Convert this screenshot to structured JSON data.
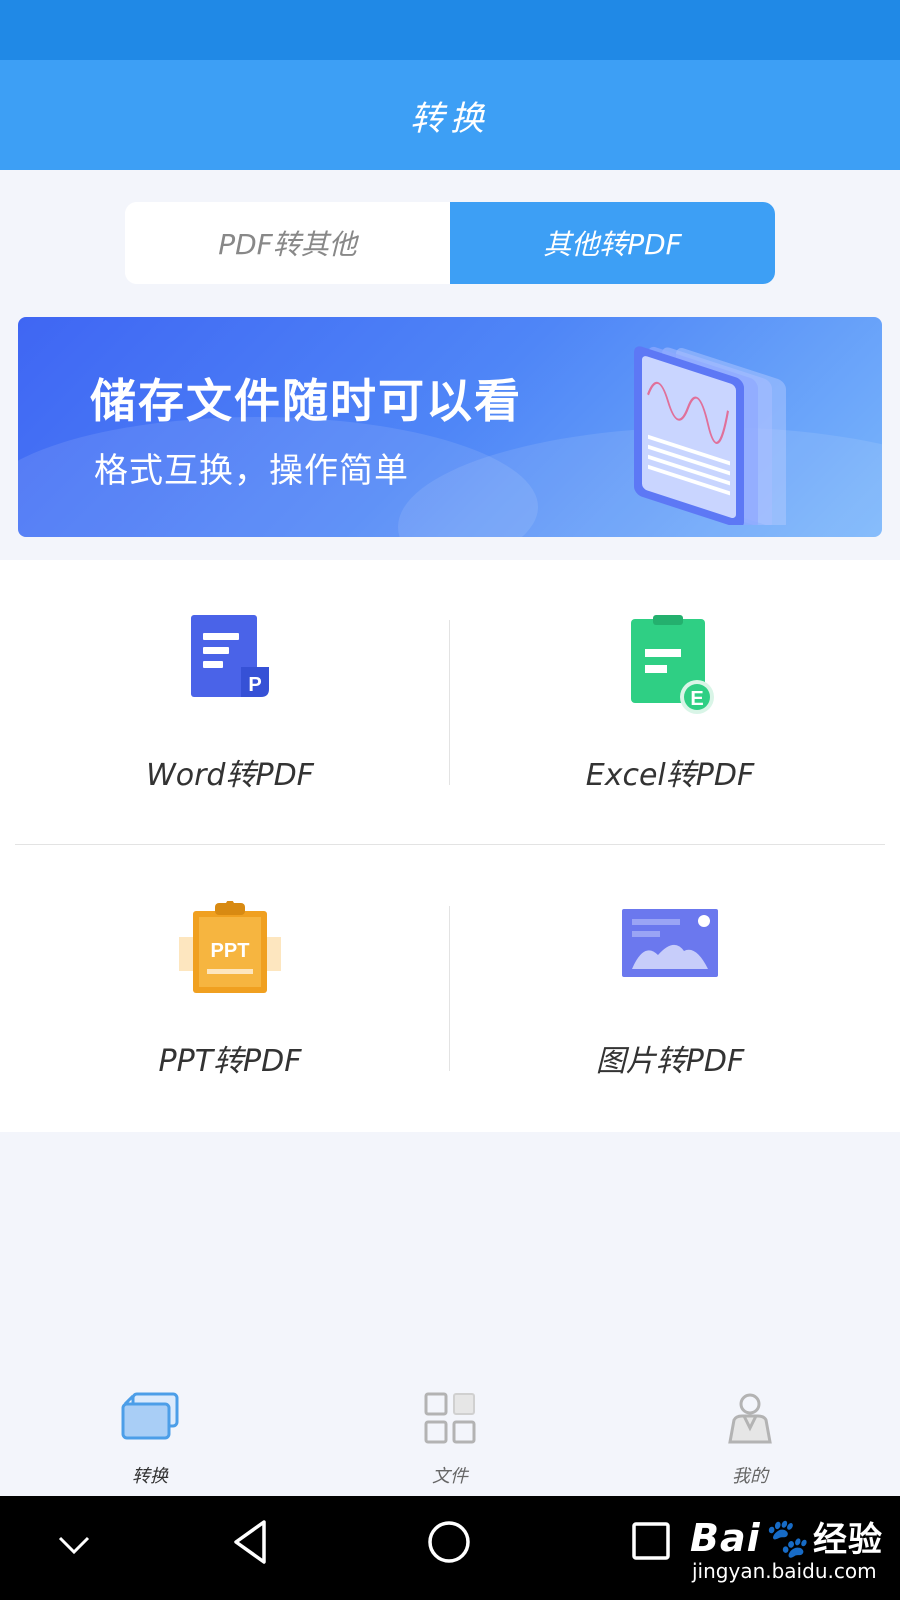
{
  "header": {
    "title": "转换"
  },
  "segment": {
    "tabs": [
      {
        "label": "PDF转其他",
        "active": false
      },
      {
        "label": "其他转PDF",
        "active": true
      }
    ]
  },
  "banner": {
    "headline": "储存文件随时可以看",
    "subline": "格式互换，操作简单"
  },
  "converters": [
    {
      "label": "Word转PDF",
      "icon": "word-doc-icon",
      "badge": "P",
      "color": "#4a63e8"
    },
    {
      "label": "Excel转PDF",
      "icon": "excel-clipboard-icon",
      "badge": "E",
      "color": "#2fcf84"
    },
    {
      "label": "PPT转PDF",
      "icon": "ppt-clipboard-icon",
      "badge": "PPT",
      "color": "#f0a020"
    },
    {
      "label": "图片转PDF",
      "icon": "image-icon",
      "color": "#6b78ee"
    }
  ],
  "tabbar": {
    "items": [
      {
        "label": "转换",
        "icon": "convert-icon",
        "active": true
      },
      {
        "label": "文件",
        "icon": "grid-icon",
        "active": false
      },
      {
        "label": "我的",
        "icon": "user-icon",
        "active": false
      }
    ]
  },
  "system_nav": {
    "icons": [
      "chevron-down-icon",
      "back-triangle-icon",
      "home-circle-icon",
      "recents-square-icon"
    ]
  },
  "watermark": {
    "brand": "Bai",
    "brand_cn": "经验",
    "site": "jingyan.baidu.com"
  },
  "colors": {
    "primary": "#3d9ff5",
    "status": "#2089e6",
    "background": "#f3f5fb"
  }
}
